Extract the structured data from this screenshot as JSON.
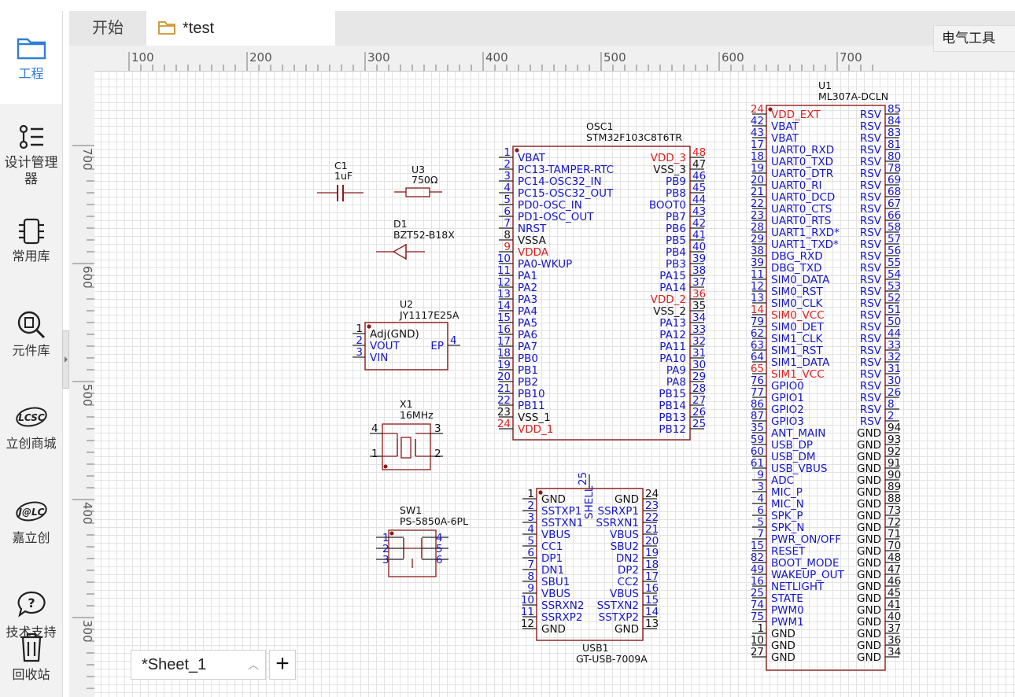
{
  "sidebar": {
    "items": [
      {
        "label": "工程",
        "icon": "folder-icon"
      },
      {
        "label": "设计管理器",
        "icon": "design-manager-icon"
      },
      {
        "label": "常用库",
        "icon": "chip-icon"
      },
      {
        "label": "元件库",
        "icon": "component-search-icon"
      },
      {
        "label": "立创商城",
        "icon": "lcsc-logo-icon"
      },
      {
        "label": "嘉立创",
        "icon": "jlc-logo-icon"
      },
      {
        "label": "技术支持",
        "icon": "help-bubble-icon"
      },
      {
        "label": "回收站",
        "icon": "trash-icon"
      }
    ]
  },
  "tabs": {
    "start": "开始",
    "test": "*test"
  },
  "right_panel": {
    "label": "电气工具"
  },
  "ruler": {
    "h": [
      "100",
      "200",
      "300",
      "400",
      "500",
      "600",
      "700",
      "800"
    ],
    "v": [
      "700",
      "600",
      "500",
      "400",
      "300"
    ]
  },
  "sheet": {
    "name": "*Sheet_1",
    "add": "+"
  },
  "colors": {
    "component": "#8b1a1a",
    "pin_blue": "#1515c8",
    "pin_red": "#e02020",
    "pin_black": "#111111"
  },
  "schematic": {
    "c1": {
      "ref": "C1",
      "value": "1uF"
    },
    "u3": {
      "ref": "U3",
      "value": "750Ω"
    },
    "d1": {
      "ref": "D1",
      "value": "BZT52-B18X"
    },
    "u2": {
      "ref": "U2",
      "value": "JY1117E25A",
      "left_pins": [
        {
          "num": "1",
          "name": "Adj(GND)",
          "c": "k"
        },
        {
          "num": "2",
          "name": "VOUT",
          "c": "b"
        },
        {
          "num": "3",
          "name": "VIN",
          "c": "b"
        }
      ],
      "right_pins": [
        {
          "num": "4",
          "name": "EP",
          "c": "b"
        }
      ]
    },
    "x1": {
      "ref": "X1",
      "value": "16MHz",
      "pins": [
        "4",
        "3",
        "1",
        "2"
      ]
    },
    "sw1": {
      "ref": "SW1",
      "value": "PS-5850A-6PL",
      "pins": [
        "1",
        "2",
        "3",
        "4",
        "5",
        "6"
      ]
    },
    "osc1": {
      "ref": "OSC1",
      "value": "STM32F103C8T6TR",
      "left_pins": [
        {
          "num": "1",
          "name": "VBAT",
          "c": "b"
        },
        {
          "num": "2",
          "name": "PC13-TAMPER-RTC",
          "c": "b"
        },
        {
          "num": "3",
          "name": "PC14-OSC32_IN",
          "c": "b"
        },
        {
          "num": "4",
          "name": "PC15-OSC32_OUT",
          "c": "b"
        },
        {
          "num": "5",
          "name": "PD0-OSC_IN",
          "c": "b"
        },
        {
          "num": "6",
          "name": "PD1-OSC_OUT",
          "c": "b"
        },
        {
          "num": "7",
          "name": "NRST",
          "c": "b"
        },
        {
          "num": "8",
          "name": "VSSA",
          "c": "k"
        },
        {
          "num": "9",
          "name": "VDDA",
          "c": "r"
        },
        {
          "num": "10",
          "name": "PA0-WKUP",
          "c": "b"
        },
        {
          "num": "11",
          "name": "PA1",
          "c": "b"
        },
        {
          "num": "12",
          "name": "PA2",
          "c": "b"
        },
        {
          "num": "13",
          "name": "PA3",
          "c": "b"
        },
        {
          "num": "14",
          "name": "PA4",
          "c": "b"
        },
        {
          "num": "15",
          "name": "PA5",
          "c": "b"
        },
        {
          "num": "16",
          "name": "PA6",
          "c": "b"
        },
        {
          "num": "17",
          "name": "PA7",
          "c": "b"
        },
        {
          "num": "18",
          "name": "PB0",
          "c": "b"
        },
        {
          "num": "19",
          "name": "PB1",
          "c": "b"
        },
        {
          "num": "20",
          "name": "PB2",
          "c": "b"
        },
        {
          "num": "21",
          "name": "PB10",
          "c": "b"
        },
        {
          "num": "22",
          "name": "PB11",
          "c": "b"
        },
        {
          "num": "23",
          "name": "VSS_1",
          "c": "k"
        },
        {
          "num": "24",
          "name": "VDD_1",
          "c": "r"
        }
      ],
      "right_pins": [
        {
          "num": "48",
          "name": "VDD_3",
          "c": "r"
        },
        {
          "num": "47",
          "name": "VSS_3",
          "c": "k"
        },
        {
          "num": "46",
          "name": "PB9",
          "c": "b"
        },
        {
          "num": "45",
          "name": "PB8",
          "c": "b"
        },
        {
          "num": "44",
          "name": "BOOT0",
          "c": "b"
        },
        {
          "num": "43",
          "name": "PB7",
          "c": "b"
        },
        {
          "num": "42",
          "name": "PB6",
          "c": "b"
        },
        {
          "num": "41",
          "name": "PB5",
          "c": "b"
        },
        {
          "num": "40",
          "name": "PB4",
          "c": "b"
        },
        {
          "num": "39",
          "name": "PB3",
          "c": "b"
        },
        {
          "num": "38",
          "name": "PA15",
          "c": "b"
        },
        {
          "num": "37",
          "name": "PA14",
          "c": "b"
        },
        {
          "num": "36",
          "name": "VDD_2",
          "c": "r"
        },
        {
          "num": "35",
          "name": "VSS_2",
          "c": "k"
        },
        {
          "num": "34",
          "name": "PA13",
          "c": "b"
        },
        {
          "num": "33",
          "name": "PA12",
          "c": "b"
        },
        {
          "num": "32",
          "name": "PA11",
          "c": "b"
        },
        {
          "num": "31",
          "name": "PA10",
          "c": "b"
        },
        {
          "num": "30",
          "name": "PA9",
          "c": "b"
        },
        {
          "num": "29",
          "name": "PA8",
          "c": "b"
        },
        {
          "num": "28",
          "name": "PB15",
          "c": "b"
        },
        {
          "num": "27",
          "name": "PB14",
          "c": "b"
        },
        {
          "num": "26",
          "name": "PB13",
          "c": "b"
        },
        {
          "num": "25",
          "name": "PB12",
          "c": "b"
        }
      ]
    },
    "usb1": {
      "ref": "USB1",
      "value": "GT-USB-7009A",
      "top_pin": {
        "num": "25",
        "name": "SHELL"
      },
      "left_pins": [
        {
          "num": "1",
          "name": "GND",
          "c": "k"
        },
        {
          "num": "2",
          "name": "SSTXP1",
          "c": "b"
        },
        {
          "num": "3",
          "name": "SSTXN1",
          "c": "b"
        },
        {
          "num": "4",
          "name": "VBUS",
          "c": "b"
        },
        {
          "num": "5",
          "name": "CC1",
          "c": "b"
        },
        {
          "num": "6",
          "name": "DP1",
          "c": "b"
        },
        {
          "num": "7",
          "name": "DN1",
          "c": "b"
        },
        {
          "num": "8",
          "name": "SBU1",
          "c": "b"
        },
        {
          "num": "9",
          "name": "VBUS",
          "c": "b"
        },
        {
          "num": "10",
          "name": "SSRXN2",
          "c": "b"
        },
        {
          "num": "11",
          "name": "SSRXP2",
          "c": "b"
        },
        {
          "num": "12",
          "name": "GND",
          "c": "k"
        }
      ],
      "right_pins": [
        {
          "num": "24",
          "name": "GND",
          "c": "k"
        },
        {
          "num": "23",
          "name": "SSRXP1",
          "c": "b"
        },
        {
          "num": "22",
          "name": "SSRXN1",
          "c": "b"
        },
        {
          "num": "21",
          "name": "VBUS",
          "c": "b"
        },
        {
          "num": "20",
          "name": "SBU2",
          "c": "b"
        },
        {
          "num": "19",
          "name": "DN2",
          "c": "b"
        },
        {
          "num": "18",
          "name": "DP2",
          "c": "b"
        },
        {
          "num": "17",
          "name": "CC2",
          "c": "b"
        },
        {
          "num": "16",
          "name": "VBUS",
          "c": "b"
        },
        {
          "num": "15",
          "name": "SSTXN2",
          "c": "b"
        },
        {
          "num": "14",
          "name": "SSTXP2",
          "c": "b"
        },
        {
          "num": "13",
          "name": "GND",
          "c": "k"
        }
      ]
    },
    "u1": {
      "ref": "U1",
      "value": "ML307A-DCLN",
      "left_pins": [
        {
          "num": "24",
          "name": "VDD_EXT",
          "c": "r"
        },
        {
          "num": "42",
          "name": "VBAT",
          "c": "b"
        },
        {
          "num": "43",
          "name": "VBAT",
          "c": "b"
        },
        {
          "num": "17",
          "name": "UART0_RXD",
          "c": "b"
        },
        {
          "num": "18",
          "name": "UART0_TXD",
          "c": "b"
        },
        {
          "num": "19",
          "name": "UART0_DTR",
          "c": "b"
        },
        {
          "num": "20",
          "name": "UART0_RI",
          "c": "b"
        },
        {
          "num": "21",
          "name": "UART0_DCD",
          "c": "b"
        },
        {
          "num": "22",
          "name": "UART0_CTS",
          "c": "b"
        },
        {
          "num": "23",
          "name": "UART0_RTS",
          "c": "b"
        },
        {
          "num": "28",
          "name": "UART1_RXD*",
          "c": "b"
        },
        {
          "num": "29",
          "name": "UART1_TXD*",
          "c": "b"
        },
        {
          "num": "38",
          "name": "DBG_RXD",
          "c": "b"
        },
        {
          "num": "39",
          "name": "DBG_TXD",
          "c": "b"
        },
        {
          "num": "11",
          "name": "SIM0_DATA",
          "c": "b"
        },
        {
          "num": "12",
          "name": "SIM0_RST",
          "c": "b"
        },
        {
          "num": "13",
          "name": "SIM0_CLK",
          "c": "b"
        },
        {
          "num": "14",
          "name": "SIM0_VCC",
          "c": "r"
        },
        {
          "num": "79",
          "name": "SIM0_DET",
          "c": "b"
        },
        {
          "num": "62",
          "name": "SIM1_CLK",
          "c": "b"
        },
        {
          "num": "63",
          "name": "SIM1_RST",
          "c": "b"
        },
        {
          "num": "64",
          "name": "SIM1_DATA",
          "c": "b"
        },
        {
          "num": "65",
          "name": "SIM1_VCC",
          "c": "r"
        },
        {
          "num": "76",
          "name": "GPIO0",
          "c": "b"
        },
        {
          "num": "77",
          "name": "GPIO1",
          "c": "b"
        },
        {
          "num": "86",
          "name": "GPIO2",
          "c": "b"
        },
        {
          "num": "87",
          "name": "GPIO3",
          "c": "b"
        },
        {
          "num": "35",
          "name": "ANT_MAIN",
          "c": "b"
        },
        {
          "num": "59",
          "name": "USB_DP",
          "c": "b"
        },
        {
          "num": "60",
          "name": "USB_DM",
          "c": "b"
        },
        {
          "num": "61",
          "name": "USB_VBUS",
          "c": "b"
        },
        {
          "num": "9",
          "name": "ADC",
          "c": "b"
        },
        {
          "num": "3",
          "name": "MIC_P",
          "c": "b"
        },
        {
          "num": "4",
          "name": "MIC_N",
          "c": "b"
        },
        {
          "num": "6",
          "name": "SPK_P",
          "c": "b"
        },
        {
          "num": "5",
          "name": "SPK_N",
          "c": "b"
        },
        {
          "num": "7",
          "name": "PWR_ON/OFF",
          "c": "b"
        },
        {
          "num": "15",
          "name": "RESET",
          "c": "b"
        },
        {
          "num": "82",
          "name": "BOOT_MODE",
          "c": "b"
        },
        {
          "num": "49",
          "name": "WAKEUP_OUT",
          "c": "b"
        },
        {
          "num": "16",
          "name": "NETLIGHT",
          "c": "b"
        },
        {
          "num": "25",
          "name": "STATE",
          "c": "b"
        },
        {
          "num": "74",
          "name": "PWM0",
          "c": "b"
        },
        {
          "num": "75",
          "name": "PWM1",
          "c": "b"
        },
        {
          "num": "1",
          "name": "GND",
          "c": "k"
        },
        {
          "num": "10",
          "name": "GND",
          "c": "k"
        },
        {
          "num": "27",
          "name": "GND",
          "c": "k"
        }
      ],
      "right_pins": [
        {
          "num": "85",
          "name": "RSV",
          "c": "b"
        },
        {
          "num": "84",
          "name": "RSV",
          "c": "b"
        },
        {
          "num": "83",
          "name": "RSV",
          "c": "b"
        },
        {
          "num": "81",
          "name": "RSV",
          "c": "b"
        },
        {
          "num": "80",
          "name": "RSV",
          "c": "b"
        },
        {
          "num": "78",
          "name": "RSV",
          "c": "b"
        },
        {
          "num": "69",
          "name": "RSV",
          "c": "b"
        },
        {
          "num": "68",
          "name": "RSV",
          "c": "b"
        },
        {
          "num": "67",
          "name": "RSV",
          "c": "b"
        },
        {
          "num": "66",
          "name": "RSV",
          "c": "b"
        },
        {
          "num": "58",
          "name": "RSV",
          "c": "b"
        },
        {
          "num": "57",
          "name": "RSV",
          "c": "b"
        },
        {
          "num": "56",
          "name": "RSV",
          "c": "b"
        },
        {
          "num": "55",
          "name": "RSV",
          "c": "b"
        },
        {
          "num": "54",
          "name": "RSV",
          "c": "b"
        },
        {
          "num": "53",
          "name": "RSV",
          "c": "b"
        },
        {
          "num": "52",
          "name": "RSV",
          "c": "b"
        },
        {
          "num": "51",
          "name": "RSV",
          "c": "b"
        },
        {
          "num": "50",
          "name": "RSV",
          "c": "b"
        },
        {
          "num": "44",
          "name": "RSV",
          "c": "b"
        },
        {
          "num": "33",
          "name": "RSV",
          "c": "b"
        },
        {
          "num": "32",
          "name": "RSV",
          "c": "b"
        },
        {
          "num": "31",
          "name": "RSV",
          "c": "b"
        },
        {
          "num": "30",
          "name": "RSV",
          "c": "b"
        },
        {
          "num": "26",
          "name": "RSV",
          "c": "b"
        },
        {
          "num": "8",
          "name": "RSV",
          "c": "b"
        },
        {
          "num": "2",
          "name": "RSV",
          "c": "b"
        },
        {
          "num": "94",
          "name": "GND",
          "c": "k"
        },
        {
          "num": "93",
          "name": "GND",
          "c": "k"
        },
        {
          "num": "92",
          "name": "GND",
          "c": "k"
        },
        {
          "num": "91",
          "name": "GND",
          "c": "k"
        },
        {
          "num": "90",
          "name": "GND",
          "c": "k"
        },
        {
          "num": "89",
          "name": "GND",
          "c": "k"
        },
        {
          "num": "88",
          "name": "GND",
          "c": "k"
        },
        {
          "num": "73",
          "name": "GND",
          "c": "k"
        },
        {
          "num": "72",
          "name": "GND",
          "c": "k"
        },
        {
          "num": "71",
          "name": "GND",
          "c": "k"
        },
        {
          "num": "70",
          "name": "GND",
          "c": "k"
        },
        {
          "num": "48",
          "name": "GND",
          "c": "k"
        },
        {
          "num": "47",
          "name": "GND",
          "c": "k"
        },
        {
          "num": "46",
          "name": "GND",
          "c": "k"
        },
        {
          "num": "45",
          "name": "GND",
          "c": "k"
        },
        {
          "num": "41",
          "name": "GND",
          "c": "k"
        },
        {
          "num": "40",
          "name": "GND",
          "c": "k"
        },
        {
          "num": "37",
          "name": "GND",
          "c": "k"
        },
        {
          "num": "36",
          "name": "GND",
          "c": "k"
        },
        {
          "num": "34",
          "name": "GND",
          "c": "k"
        }
      ]
    }
  }
}
